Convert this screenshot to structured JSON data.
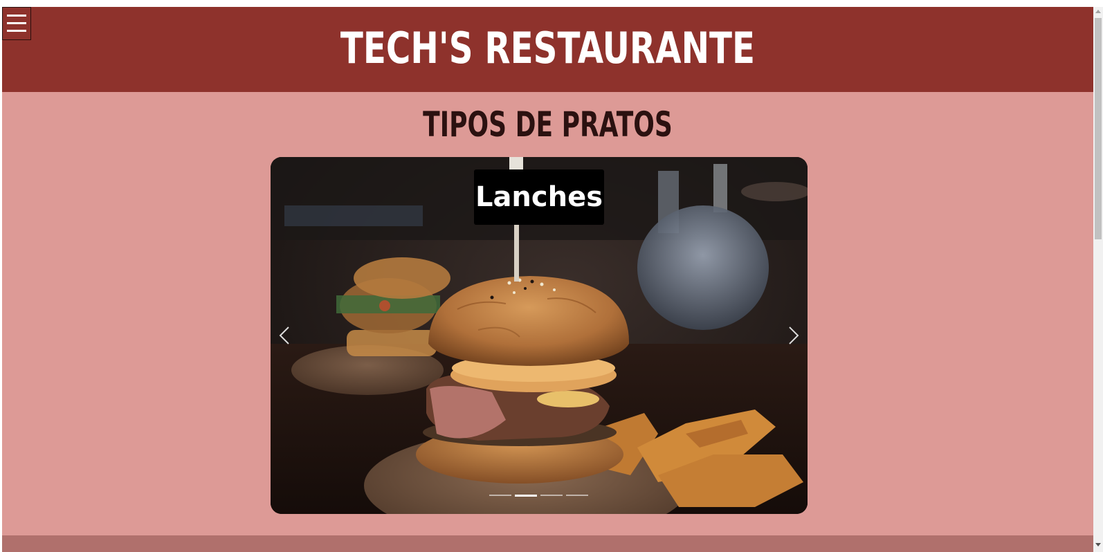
{
  "header": {
    "title": "TECH'S RESTAURANTE",
    "menu_icon": "hamburger-menu-icon"
  },
  "section": {
    "title": "TIPOS DE PRATOS"
  },
  "carousel": {
    "caption": "Lanches",
    "prev_icon": "chevron-left-icon",
    "next_icon": "chevron-right-icon",
    "slide_count": 4,
    "active_index": 1
  },
  "colors": {
    "header_bg": "#8e322c",
    "page_bg": "#dd9a96",
    "section_title": "#2b1110"
  }
}
